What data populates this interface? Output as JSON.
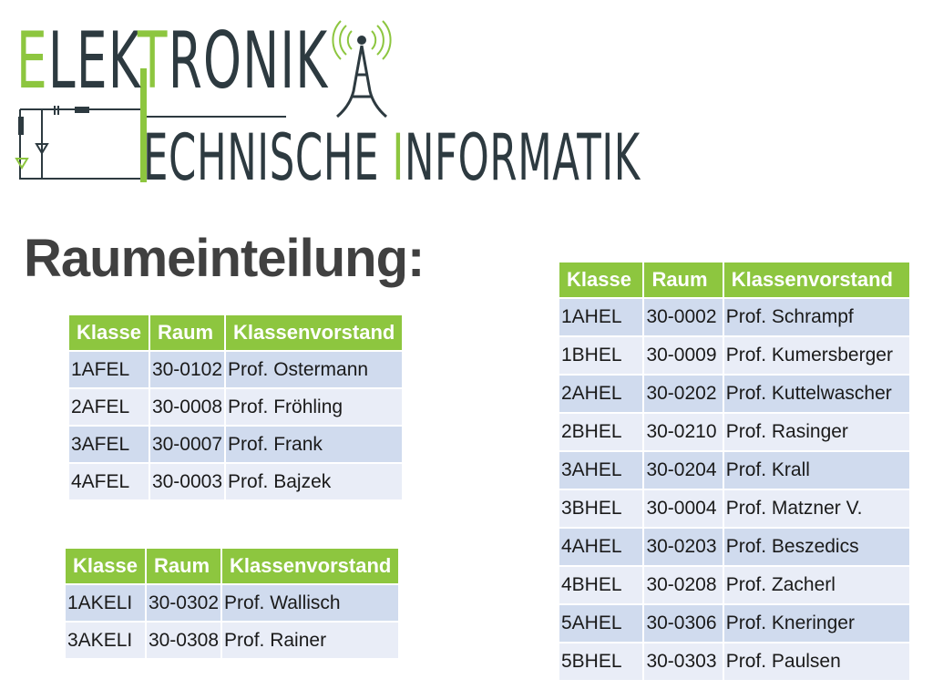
{
  "logo": {
    "line1": [
      "E",
      "LEK",
      "T",
      "RONIK"
    ],
    "line2": [
      "ECHNISCHE ",
      "I",
      "NFORMATIK"
    ]
  },
  "title": "Raumeinteilung:",
  "tables": [
    {
      "headers": [
        "Klasse",
        "Raum",
        "Klassenvorstand"
      ],
      "rows": [
        [
          "1AFEL",
          "30-0102",
          "Prof. Ostermann"
        ],
        [
          "2AFEL",
          "30-0008",
          "Prof. Fröhling"
        ],
        [
          "3AFEL",
          "30-0007",
          "Prof. Frank"
        ],
        [
          "4AFEL",
          "30-0003",
          "Prof. Bajzek"
        ]
      ]
    },
    {
      "headers": [
        "Klasse",
        "Raum",
        "Klassenvorstand"
      ],
      "rows": [
        [
          "1AKELI",
          "30-0302",
          "Prof. Wallisch"
        ],
        [
          "3AKELI",
          "30-0308",
          "Prof. Rainer"
        ]
      ]
    },
    {
      "headers": [
        "Klasse",
        "Raum",
        "Klassenvorstand"
      ],
      "rows": [
        [
          "1AHEL",
          "30-0002",
          "Prof. Schrampf"
        ],
        [
          "1BHEL",
          "30-0009",
          "Prof. Kumersberger"
        ],
        [
          "2AHEL",
          "30-0202",
          "Prof. Kuttelwascher"
        ],
        [
          "2BHEL",
          "30-0210",
          "Prof. Rasinger"
        ],
        [
          "3AHEL",
          "30-0204",
          "Prof. Krall"
        ],
        [
          "3BHEL",
          "30-0004",
          "Prof. Matzner V."
        ],
        [
          "4AHEL",
          "30-0203",
          "Prof. Beszedics"
        ],
        [
          "4BHEL",
          "30-0208",
          "Prof. Zacherl"
        ],
        [
          "5AHEL",
          "30-0306",
          "Prof. Kneringer"
        ],
        [
          "5BHEL",
          "30-0303",
          "Prof. Paulsen"
        ]
      ]
    }
  ],
  "colors": {
    "accent": "#8dc63f",
    "text": "#404040",
    "row_odd": "#d0dbee",
    "row_even": "#e9edf7"
  }
}
